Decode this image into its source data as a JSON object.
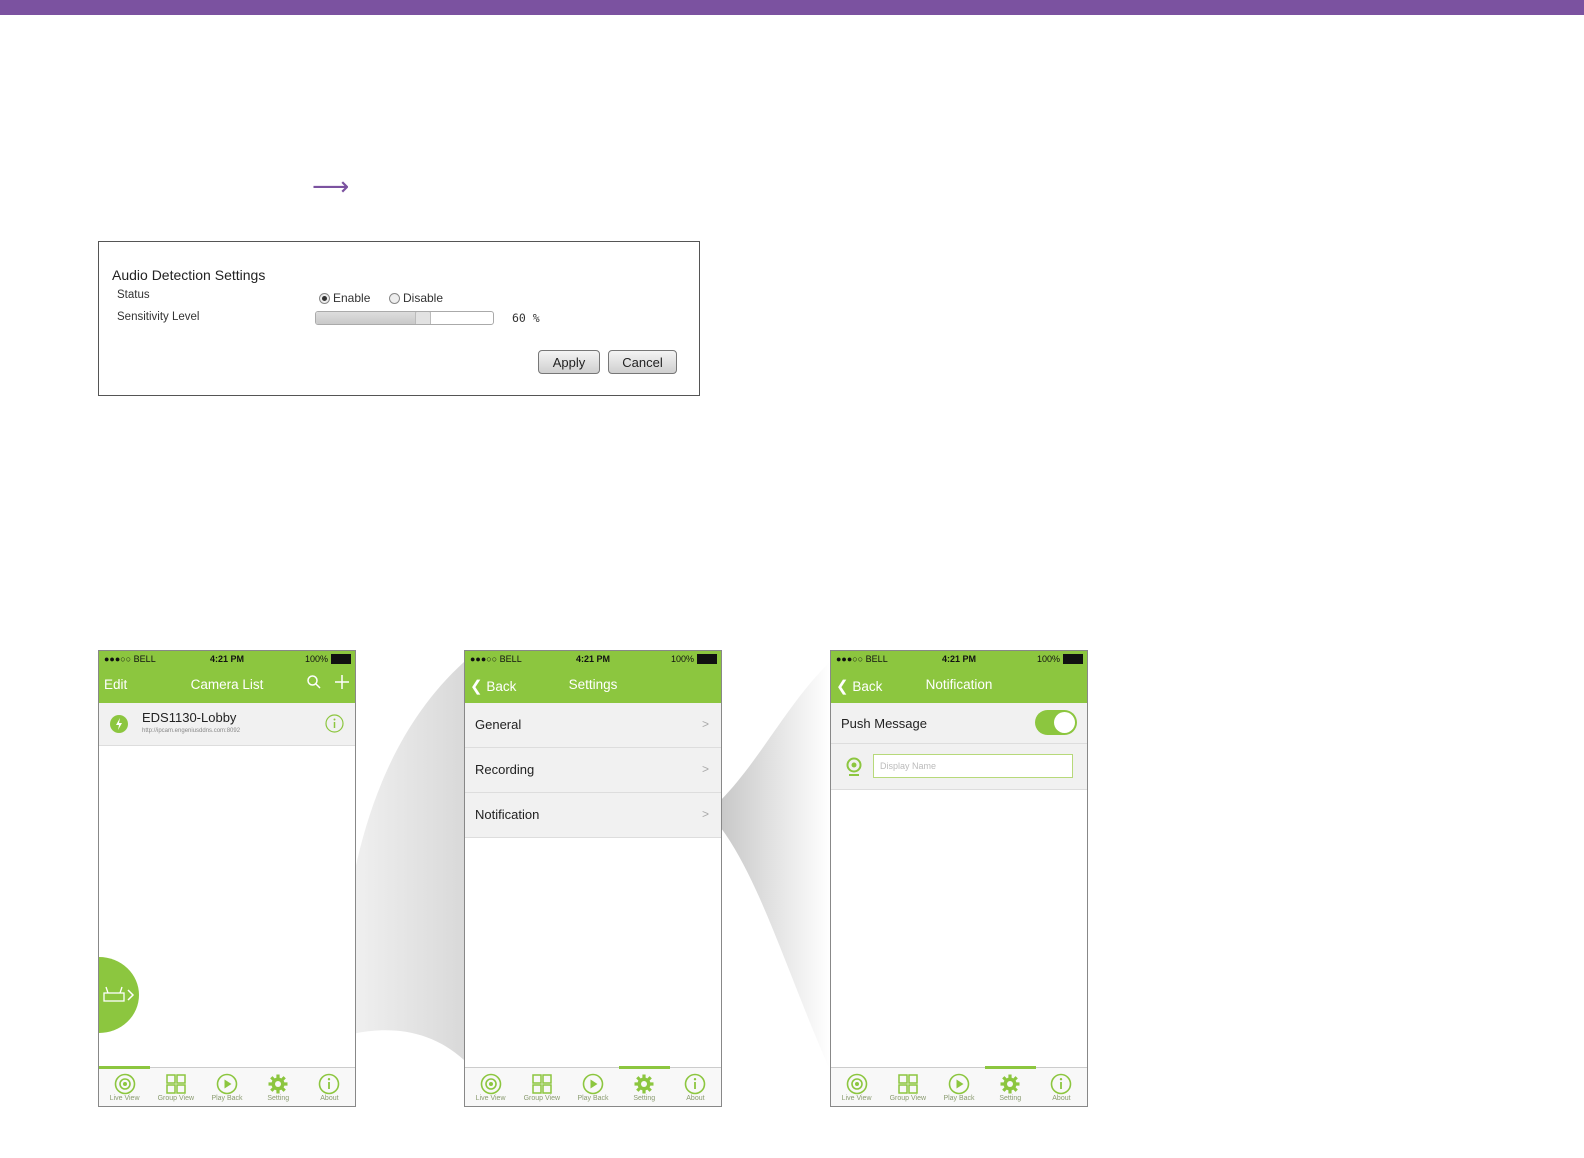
{
  "colors": {
    "accent_purple": "#7b52a0",
    "app_green": "#8cc63f"
  },
  "audio_panel": {
    "title": "Audio Detection Settings",
    "status_label": "Status",
    "enable_label": "Enable",
    "disable_label": "Disable",
    "status_value": "Enable",
    "sensitivity_label": "Sensitivity Level",
    "sensitivity_value": 60,
    "sensitivity_text": "60 %",
    "apply_label": "Apply",
    "cancel_label": "Cancel"
  },
  "status_bar": {
    "carrier": "●●●○○ BELL",
    "time": "4:21 PM",
    "battery": "100%"
  },
  "tabs": [
    {
      "label": "Live View",
      "icon": "live-view-icon"
    },
    {
      "label": "Group View",
      "icon": "group-view-icon"
    },
    {
      "label": "Play Back",
      "icon": "play-back-icon"
    },
    {
      "label": "Setting",
      "icon": "gear-icon"
    },
    {
      "label": "About",
      "icon": "info-icon"
    }
  ],
  "phone1": {
    "nav_left": "Edit",
    "title": "Camera List",
    "camera_name": "EDS1130-Lobby",
    "camera_url": "http://ipcam.engeniusddns.com:8092"
  },
  "phone2": {
    "back": "Back",
    "title": "Settings",
    "items": [
      "General",
      "Recording",
      "Notification"
    ]
  },
  "phone3": {
    "back": "Back",
    "title": "Notification",
    "push_label": "Push Message",
    "push_enabled": true,
    "display_name_placeholder": "Display Name"
  }
}
